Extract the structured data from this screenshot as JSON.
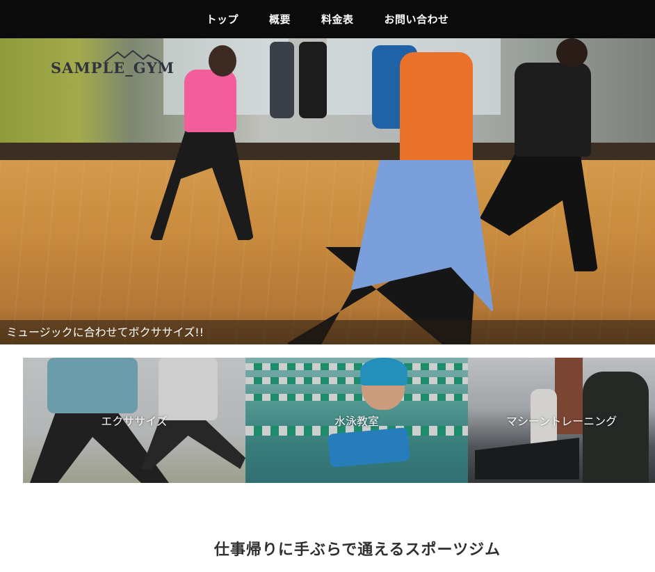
{
  "nav": {
    "items": [
      {
        "label": "トップ"
      },
      {
        "label": "概要"
      },
      {
        "label": "料金表"
      },
      {
        "label": "お問い合わせ"
      }
    ]
  },
  "hero": {
    "logo_text": "SAMPLE_GYM",
    "caption": "ミュージックに合わせてボクササイズ!!"
  },
  "cards": [
    {
      "label": "エクササイズ"
    },
    {
      "label": "水泳教室"
    },
    {
      "label": "マシーントレーニング"
    }
  ],
  "section": {
    "heading": "仕事帰りに手ぶらで通えるスポーツジム"
  },
  "colors": {
    "nav_background": "#0b0b0b",
    "nav_text": "#ffffff",
    "heading_text": "#2f2f2f"
  }
}
